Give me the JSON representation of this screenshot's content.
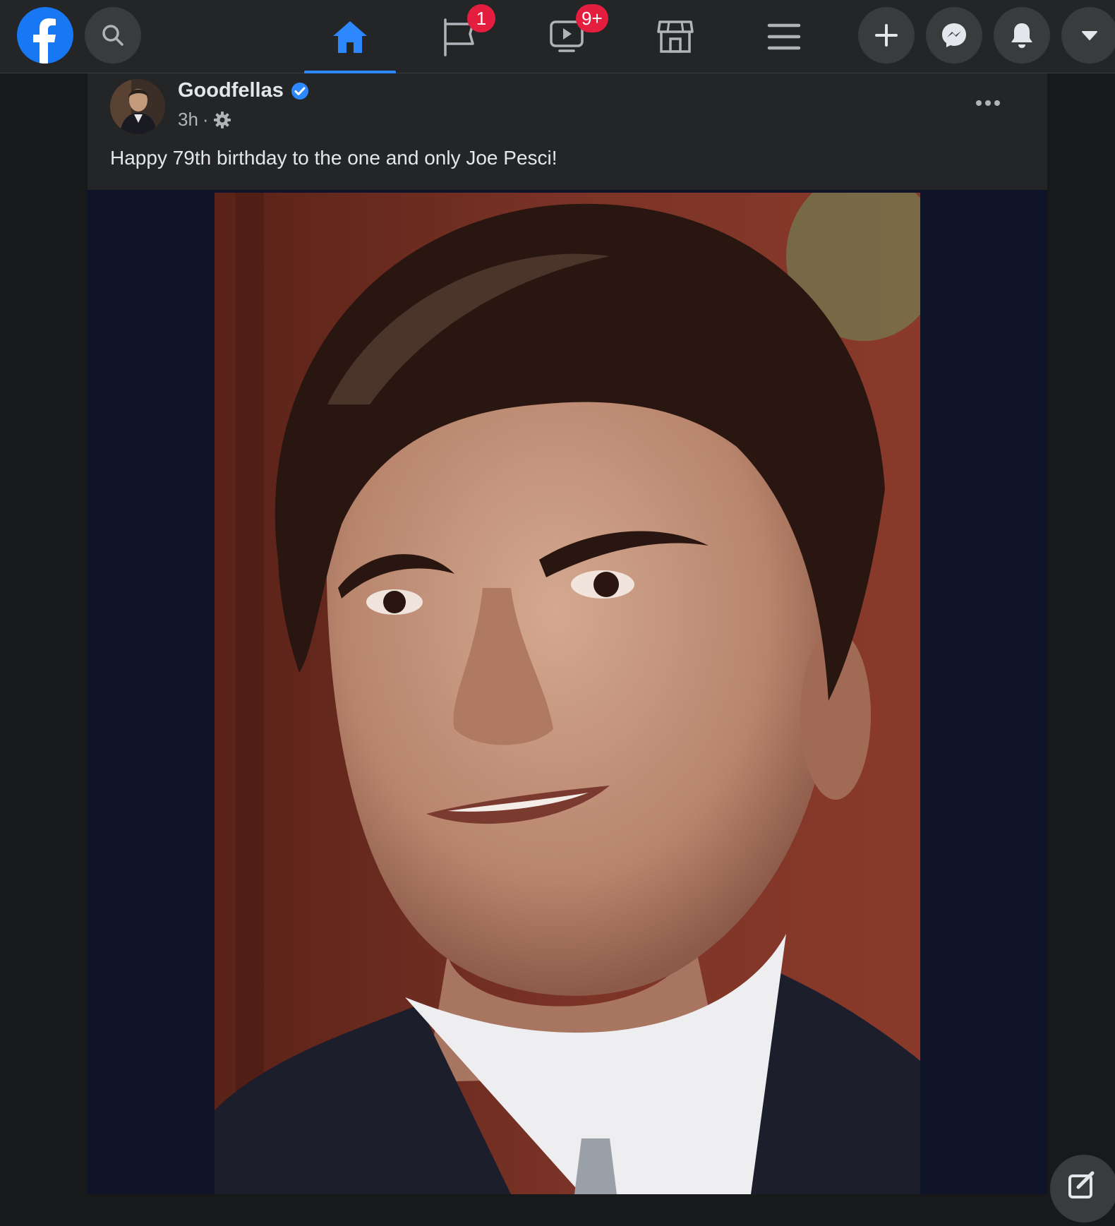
{
  "topbar": {
    "logo_icon": "facebook-logo-icon",
    "search_icon": "search-icon",
    "tabs": [
      {
        "name": "home",
        "icon": "home-icon",
        "active": true,
        "badge": ""
      },
      {
        "name": "pages",
        "icon": "flag-icon",
        "active": false,
        "badge": "1"
      },
      {
        "name": "watch",
        "icon": "video-icon",
        "active": false,
        "badge": "9+"
      },
      {
        "name": "marketplace",
        "icon": "store-icon",
        "active": false,
        "badge": ""
      },
      {
        "name": "menu",
        "icon": "hamburger-icon",
        "active": false,
        "badge": ""
      }
    ],
    "actions": [
      "plus-icon",
      "messenger-icon",
      "bell-icon",
      "caret-down-icon"
    ]
  },
  "post": {
    "author": "Goodfellas",
    "verified": true,
    "time": "3h",
    "separator": "·",
    "privacy_icon": "gear-icon",
    "text": "Happy 79th birthday to the one and only Joe Pesci!",
    "more_icon": "more-options-icon",
    "photo": "portrait of a smiling man with swept-back dark hair, dark suit, white shirt and patterned tie"
  },
  "colors": {
    "topbar_bg": "#242526",
    "page_bg": "#18191a",
    "accent": "#2d88ff",
    "badge": "#e41e3f",
    "media_bg": "#101428"
  },
  "floating": {
    "compose_icon": "compose-icon"
  }
}
